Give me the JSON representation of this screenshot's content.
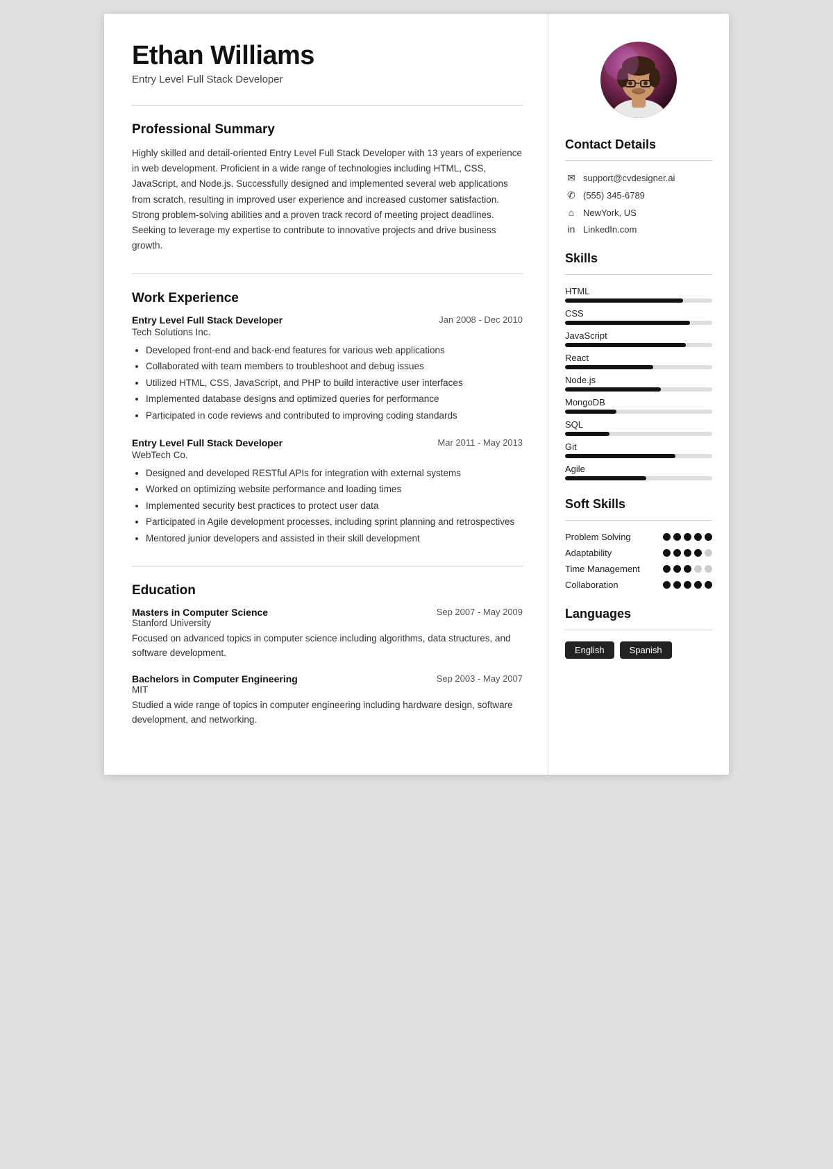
{
  "header": {
    "name": "Ethan Williams",
    "title": "Entry Level Full Stack Developer"
  },
  "contact": {
    "section_title": "Contact Details",
    "email": "support@cvdesigner.ai",
    "phone": "(555) 345-6789",
    "location": "NewYork, US",
    "linkedin": "LinkedIn.com"
  },
  "summary": {
    "section_title": "Professional Summary",
    "text": "Highly skilled and detail-oriented Entry Level Full Stack Developer with 13 years of experience in web development. Proficient in a wide range of technologies including HTML, CSS, JavaScript, and Node.js. Successfully designed and implemented several web applications from scratch, resulting in improved user experience and increased customer satisfaction. Strong problem-solving abilities and a proven track record of meeting project deadlines. Seeking to leverage my expertise to contribute to innovative projects and drive business growth."
  },
  "work_experience": {
    "section_title": "Work Experience",
    "jobs": [
      {
        "title": "Entry Level Full Stack Developer",
        "company": "Tech Solutions Inc.",
        "date": "Jan 2008 - Dec 2010",
        "bullets": [
          "Developed front-end and back-end features for various web applications",
          "Collaborated with team members to troubleshoot and debug issues",
          "Utilized HTML, CSS, JavaScript, and PHP to build interactive user interfaces",
          "Implemented database designs and optimized queries for performance",
          "Participated in code reviews and contributed to improving coding standards"
        ]
      },
      {
        "title": "Entry Level Full Stack Developer",
        "company": "WebTech Co.",
        "date": "Mar 2011 - May 2013",
        "bullets": [
          "Designed and developed RESTful APIs for integration with external systems",
          "Worked on optimizing website performance and loading times",
          "Implemented security best practices to protect user data",
          "Participated in Agile development processes, including sprint planning and retrospectives",
          "Mentored junior developers and assisted in their skill development"
        ]
      }
    ]
  },
  "education": {
    "section_title": "Education",
    "items": [
      {
        "degree": "Masters in Computer Science",
        "school": "Stanford University",
        "date": "Sep 2007 - May 2009",
        "desc": "Focused on advanced topics in computer science including algorithms, data structures, and software development."
      },
      {
        "degree": "Bachelors in Computer Engineering",
        "school": "MIT",
        "date": "Sep 2003 - May 2007",
        "desc": "Studied a wide range of topics in computer engineering including hardware design, software development, and networking."
      }
    ]
  },
  "skills": {
    "section_title": "Skills",
    "items": [
      {
        "name": "HTML",
        "pct": 80
      },
      {
        "name": "CSS",
        "pct": 85
      },
      {
        "name": "JavaScript",
        "pct": 82
      },
      {
        "name": "React",
        "pct": 60
      },
      {
        "name": "Node.js",
        "pct": 65
      },
      {
        "name": "MongoDB",
        "pct": 35
      },
      {
        "name": "SQL",
        "pct": 30
      },
      {
        "name": "Git",
        "pct": 75
      },
      {
        "name": "Agile",
        "pct": 55
      }
    ]
  },
  "soft_skills": {
    "section_title": "Soft Skills",
    "items": [
      {
        "name": "Problem Solving",
        "filled": 5,
        "total": 5
      },
      {
        "name": "Adaptability",
        "filled": 4,
        "total": 5
      },
      {
        "name": "Time Management",
        "filled": 3,
        "total": 5
      },
      {
        "name": "Collaboration",
        "filled": 5,
        "total": 5
      }
    ]
  },
  "languages": {
    "section_title": "Languages",
    "items": [
      "English",
      "Spanish"
    ]
  }
}
